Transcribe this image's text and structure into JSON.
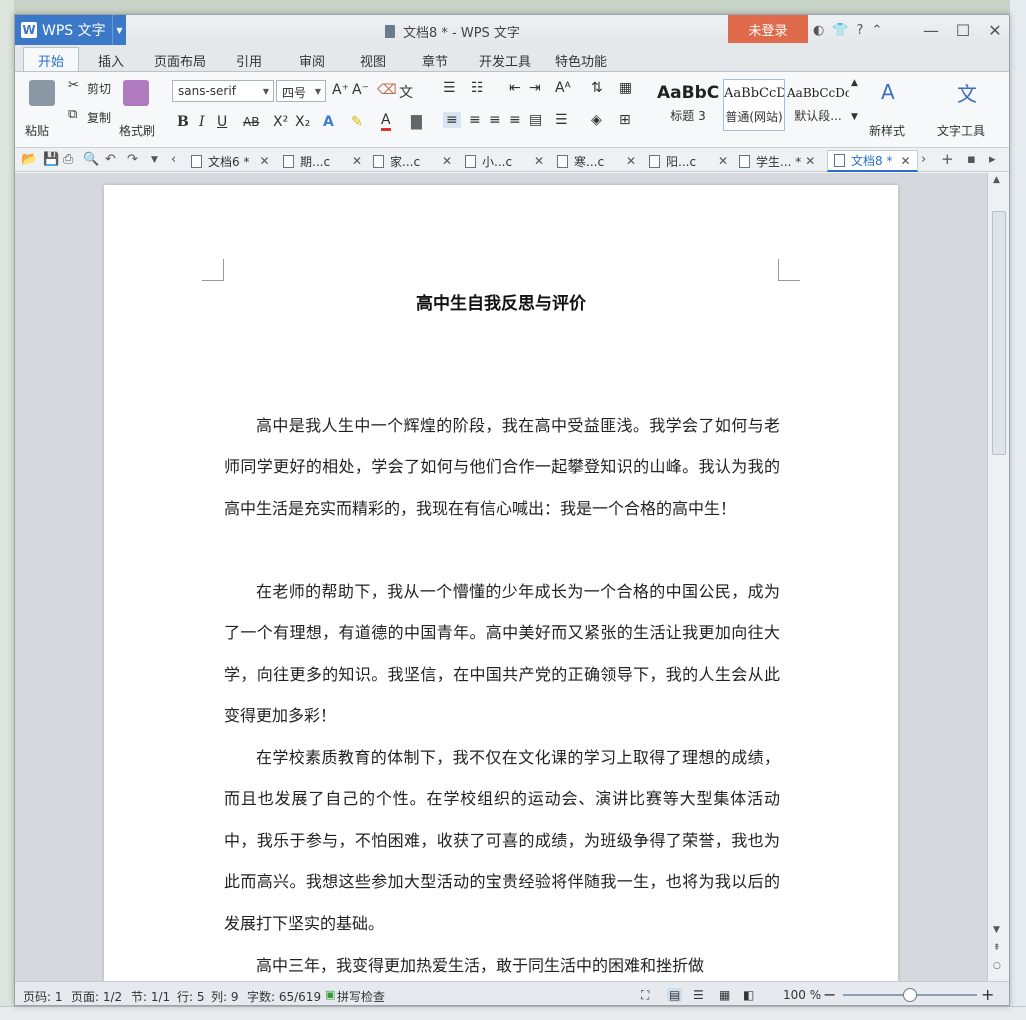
{
  "app": {
    "menu_label": "WPS 文字",
    "window_title": "文档8 * - WPS 文字",
    "login_label": "未登录",
    "help_label": "?"
  },
  "ribbon_tabs": [
    "开始",
    "插入",
    "页面布局",
    "引用",
    "审阅",
    "视图",
    "章节",
    "开发工具",
    "特色功能"
  ],
  "ribbon": {
    "paste": "粘贴",
    "cut": "剪切",
    "copy": "复制",
    "format_painter": "格式刷",
    "font_name": "sans-serif",
    "font_size": "四号",
    "bold": "B",
    "italic": "I",
    "underline": "U",
    "strike": "AB",
    "superscript": "X²",
    "subscript": "X₂",
    "styles": [
      {
        "sample": "AaBbC",
        "name": "标题 3"
      },
      {
        "sample": "AaBbCcD",
        "name": "普通(网站)"
      },
      {
        "sample": "AaBbCcDc",
        "name": "默认段..."
      }
    ],
    "new_style": "新样式",
    "text_tools": "文字工具"
  },
  "doc_tabs": [
    {
      "label": "文档6 *"
    },
    {
      "label": "期...c"
    },
    {
      "label": "家...c"
    },
    {
      "label": "小...c"
    },
    {
      "label": "寒...c"
    },
    {
      "label": "阳...c"
    },
    {
      "label": "学生... *"
    },
    {
      "label": "文档8 *"
    }
  ],
  "document": {
    "heading": "高中生自我反思与评价",
    "paragraphs": [
      "高中是我人生中一个辉煌的阶段，我在高中受益匪浅。我学会了如何与老师同学更好的相处，学会了如何与他们合作一起攀登知识的山峰。我认为我的高中生活是充实而精彩的，我现在有信心喊出：我是一个合格的高中生！",
      "在老师的帮助下，我从一个懵懂的少年成长为一个合格的中国公民，成为了一个有理想，有道德的中国青年。高中美好而又紧张的生活让我更加向往大学，向往更多的知识。我坚信，在中国共产党的正确领导下，我的人生会从此变得更加多彩！",
      "在学校素质教育的体制下，我不仅在文化课的学习上取得了理想的成绩，而且也发展了自己的个性。在学校组织的运动会、演讲比赛等大型集体活动中，我乐于参与，不怕困难，收获了可喜的成绩，为班级争得了荣誉，我也为此而高兴。我想这些参加大型活动的宝贵经验将伴随我一生，也将为我以后的发展打下坚实的基础。",
      "高中三年，我变得更加热爱生活，敢于同生活中的困难和挫折做"
    ]
  },
  "status": {
    "page_code": "页码: 1",
    "pages": "页面: 1/2",
    "section": "节: 1/1",
    "row": "行: 5",
    "col": "列: 9",
    "word_count": "字数: 65/619",
    "spell_check": "拼写检查",
    "zoom": "100 %"
  }
}
